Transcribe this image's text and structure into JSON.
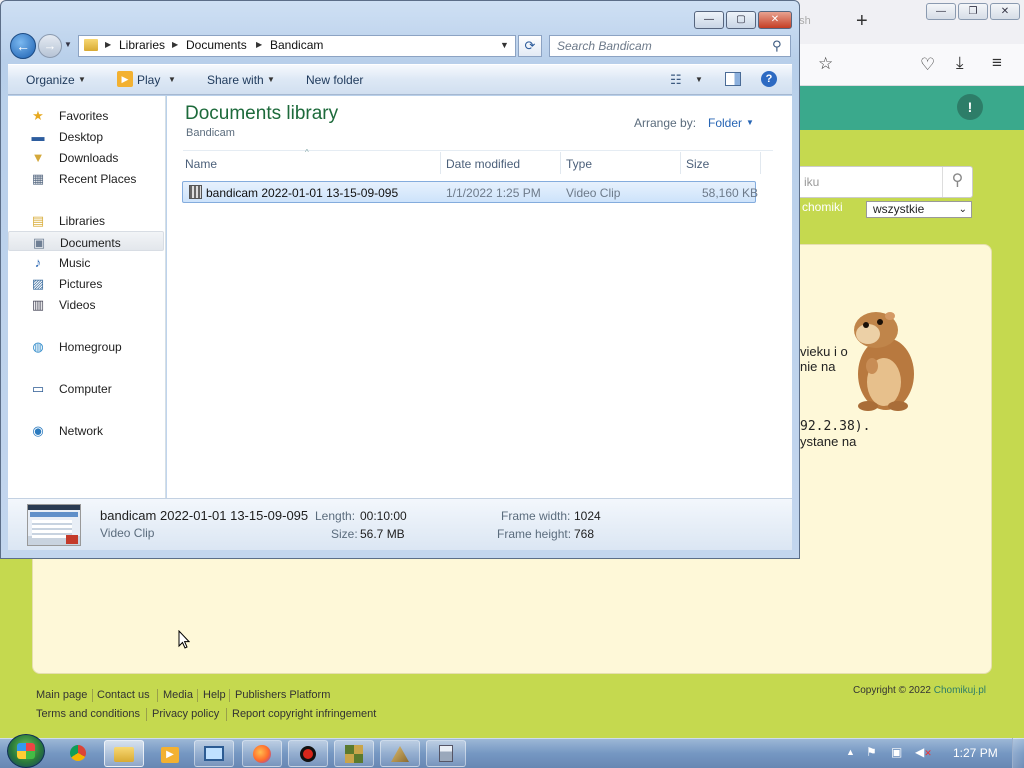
{
  "browser": {
    "tab_fragment": "e sh",
    "new_tab": "+",
    "site": {
      "search_placeholder": "iku",
      "chomiki_label": "chomiki",
      "select_value": "wszystkie",
      "text_lines": [
        "vieku i o",
        "nie na",
        "92.2.38).",
        "ystane na"
      ],
      "footer_links": [
        "Main page",
        "Contact us",
        "Media",
        "Help",
        "Publishers Platform",
        "Terms and conditions",
        "Privacy policy",
        "Report copyright infringement"
      ],
      "copyright_prefix": "Copyright © 2022",
      "copyright_brand": "Chomikuj.pl"
    }
  },
  "explorer": {
    "window_controls": {
      "minimize": "—",
      "maximize": "▢",
      "close": "✕"
    },
    "address": {
      "crumbs": [
        "Libraries",
        "Documents",
        "Bandicam"
      ]
    },
    "search": {
      "placeholder": "Search Bandicam"
    },
    "toolbar": {
      "organize": "Organize",
      "play": "Play",
      "share_with": "Share with",
      "new_folder": "New folder"
    },
    "nav": [
      {
        "label": "Favorites",
        "icon": "star-icon"
      },
      {
        "label": "Desktop",
        "icon": "desktop-icon"
      },
      {
        "label": "Downloads",
        "icon": "downloads-icon"
      },
      {
        "label": "Recent Places",
        "icon": "recent-places-icon"
      },
      {
        "label": "Libraries",
        "icon": "libraries-icon"
      },
      {
        "label": "Documents",
        "icon": "documents-icon",
        "selected": true
      },
      {
        "label": "Music",
        "icon": "music-icon"
      },
      {
        "label": "Pictures",
        "icon": "pictures-icon"
      },
      {
        "label": "Videos",
        "icon": "videos-icon"
      },
      {
        "label": "Homegroup",
        "icon": "homegroup-icon"
      },
      {
        "label": "Computer",
        "icon": "computer-icon"
      },
      {
        "label": "Network",
        "icon": "network-icon"
      }
    ],
    "library": {
      "title": "Documents library",
      "subtitle": "Bandicam",
      "arrange_label": "Arrange by:",
      "arrange_value": "Folder"
    },
    "columns": [
      "Name",
      "Date modified",
      "Type",
      "Size"
    ],
    "files": [
      {
        "name": "bandicam 2022-01-01 13-15-09-095",
        "date": "1/1/2022 1:25 PM",
        "type": "Video Clip",
        "size": "58,160 KB"
      }
    ],
    "details": {
      "name": "bandicam 2022-01-01 13-15-09-095",
      "type": "Video Clip",
      "length_label": "Length:",
      "length": "00:10:00",
      "size_label": "Size:",
      "size": "56.7 MB",
      "frame_width_label": "Frame width:",
      "frame_width": "1024",
      "frame_height_label": "Frame height:",
      "frame_height": "768"
    }
  },
  "taskbar": {
    "clock": "1:27 PM"
  },
  "colors": {
    "library_title": "#1d6a3b",
    "selection": "#cde3fb",
    "site_green": "#3aa98c",
    "page_lime": "#c5d94f"
  }
}
